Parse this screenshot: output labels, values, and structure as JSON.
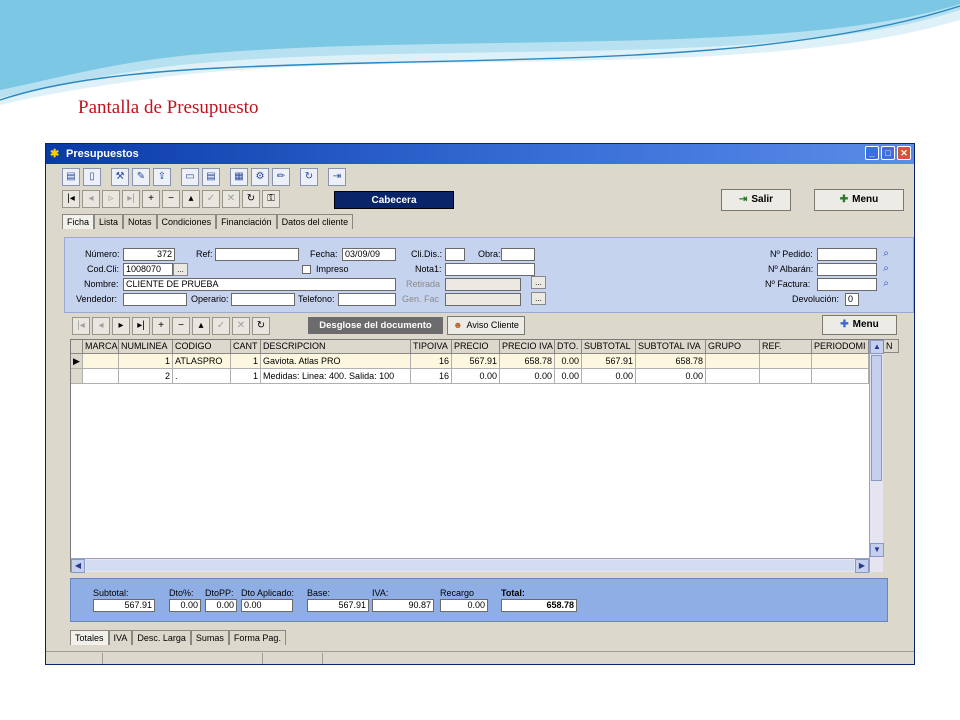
{
  "slide": {
    "title": "Pantalla de Presupuesto"
  },
  "window": {
    "title": "Presupuestos",
    "icon": "app-icon"
  },
  "toolbar": {
    "icons": [
      "print-icon",
      "document-icon",
      "tools-icon",
      "edit-icon",
      "export-icon",
      "window-icon",
      "window-split-icon",
      "calc-icon",
      "gear-icon",
      "pencil-icon",
      "refresh-icon",
      "exit-door-icon"
    ]
  },
  "nav": {
    "buttons": [
      "|◂",
      "◂",
      "▹",
      "▸|",
      "+",
      "−",
      "▴",
      "✓",
      "✕",
      "↻",
      "🔓"
    ],
    "section_label": "Cabecera",
    "salir_label": "Salir",
    "menu_label": "Menu"
  },
  "tabs_top": [
    "Ficha",
    "Lista",
    "Notas",
    "Condiciones",
    "Financiación",
    "Datos del cliente"
  ],
  "header": {
    "numero_label": "Número:",
    "numero_value": "372",
    "ref_label": "Ref:",
    "ref_value": "",
    "fecha_label": "Fecha:",
    "fecha_value": "03/09/09",
    "codcli_label": "Cod.Cli:",
    "codcli_value": "1008070",
    "impreso_label": "Impreso",
    "nombre_label": "Nombre:",
    "nombre_value": "CLIENTE DE PRUEBA",
    "vendedor_label": "Vendedor:",
    "vendedor_value": "",
    "operario_label": "Operario:",
    "operario_value": "",
    "telefono_label": "Telefono:",
    "telefono_value": "",
    "clidis_label": "Cli.Dis.:",
    "clidis_value": "",
    "obra_label": "Obra:",
    "obra_value": "",
    "nota1_label": "Nota1:",
    "nota1_value": "",
    "retirada_label": "Retirada",
    "retirada_value": "",
    "genfac_label": "Gen. Fac",
    "genfac_value": "",
    "pedido_label": "Nº Pedido:",
    "pedido_value": "",
    "albaran_label": "Nº Albarán:",
    "albaran_value": "",
    "factura_label": "Nº Factura:",
    "factura_value": "",
    "devolucion_label": "Devolución:",
    "devolucion_value": "0"
  },
  "detail_toolbar": {
    "desglose_label": "Desglose del documento",
    "aviso_label": "Aviso Cliente",
    "menu_label": "Menu"
  },
  "grid": {
    "columns": [
      "MARCA",
      "NUMLINEA",
      "CODIGO",
      "CANT",
      "DESCRIPCION",
      "TIPOIVA",
      "PRECIO",
      "PRECIO IVA",
      "DTO.",
      "SUBTOTAL",
      "SUBTOTAL IVA",
      "GRUPO",
      "REF.",
      "PERIODOMI",
      "N"
    ],
    "rows": [
      {
        "marca": "",
        "numlinea": "1",
        "codigo": "ATLASPRO",
        "cant": "1",
        "descripcion": "Gaviota. Atlas PRO",
        "tipoiva": "16",
        "precio": "567.91",
        "precio_iva": "658.78",
        "dto": "0.00",
        "subtotal": "567.91",
        "subtotal_iva": "658.78",
        "grupo": "",
        "ref": "",
        "periodo": ""
      },
      {
        "marca": "",
        "numlinea": "2",
        "codigo": ".",
        "cant": "1",
        "descripcion": "Medidas:   Linea: 400.   Salida: 100",
        "tipoiva": "16",
        "precio": "0.00",
        "precio_iva": "0.00",
        "dto": "0.00",
        "subtotal": "0.00",
        "subtotal_iva": "0.00",
        "grupo": "",
        "ref": "",
        "periodo": ""
      }
    ]
  },
  "totals": {
    "subtotal_label": "Subtotal:",
    "subtotal_value": "567.91",
    "dto_label": "Dto%:",
    "dto_value": "0.00",
    "dtopp_label": "DtoPP:",
    "dtopp_value": "0.00",
    "dtoapl_label": "Dto Aplicado:",
    "dtoapl_value": "0.00",
    "base_label": "Base:",
    "base_value": "567.91",
    "iva_label": "IVA:",
    "iva_value": "90.87",
    "recargo_label": "Recargo",
    "recargo_value": "0.00",
    "total_label": "Total:",
    "total_value": "658.78"
  },
  "tabs_bottom": [
    "Totales",
    "IVA",
    "Desc. Larga",
    "Sumas",
    "Forma Pag."
  ]
}
